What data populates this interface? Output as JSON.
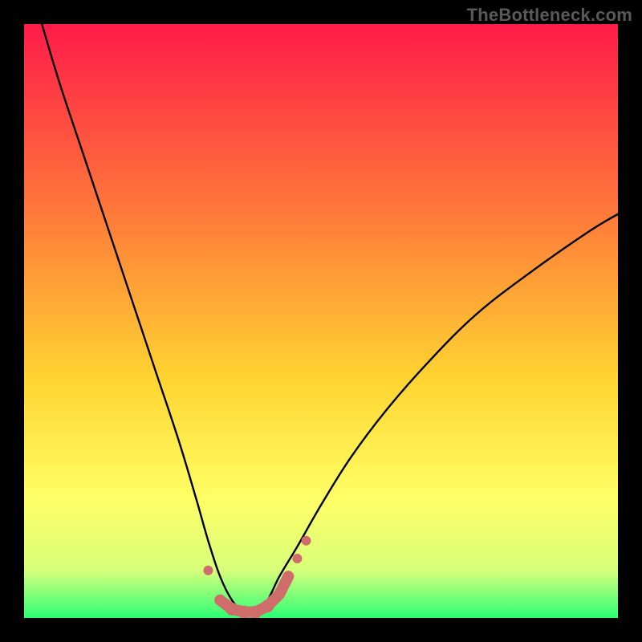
{
  "watermark": "TheBottleneck.com",
  "colors": {
    "frame": "#000000",
    "gradient_top": "#ff1b49",
    "gradient_mid1": "#ff7a3a",
    "gradient_mid2": "#ffd531",
    "gradient_mid3": "#ffff66",
    "gradient_mid4": "#d7ff7a",
    "gradient_bottom": "#2cff76",
    "curve": "#000000",
    "marker_fill": "#cf6d6b",
    "marker_stroke": "#cf6d6b"
  },
  "chart_data": {
    "type": "line",
    "title": "",
    "xlabel": "",
    "ylabel": "",
    "xlim": [
      0,
      100
    ],
    "ylim": [
      0,
      100
    ],
    "series": [
      {
        "name": "bottleneck-curve",
        "x": [
          3,
          6,
          10,
          14,
          18,
          22,
          26,
          29,
          31,
          33,
          35,
          37,
          39,
          41,
          43,
          46,
          50,
          55,
          61,
          68,
          76,
          85,
          95,
          100
        ],
        "y": [
          100,
          90,
          78,
          66,
          54,
          42,
          30,
          20,
          13,
          7,
          3,
          1,
          1,
          3,
          7,
          12,
          19,
          27,
          35,
          43,
          51,
          58,
          65,
          68
        ]
      }
    ],
    "markers": [
      {
        "x": 31,
        "y": 8,
        "r": 6
      },
      {
        "x": 33,
        "y": 3,
        "r": 7
      },
      {
        "x": 35,
        "y": 1.5,
        "r": 8
      },
      {
        "x": 37,
        "y": 1,
        "r": 8
      },
      {
        "x": 39,
        "y": 1,
        "r": 8
      },
      {
        "x": 41,
        "y": 2,
        "r": 8
      },
      {
        "x": 43,
        "y": 4,
        "r": 7
      },
      {
        "x": 44.5,
        "y": 7,
        "r": 6
      },
      {
        "x": 46,
        "y": 10,
        "r": 6
      },
      {
        "x": 47.5,
        "y": 13,
        "r": 6
      }
    ],
    "connector": {
      "from_index": 1,
      "to_index": 7,
      "width": 14
    }
  }
}
